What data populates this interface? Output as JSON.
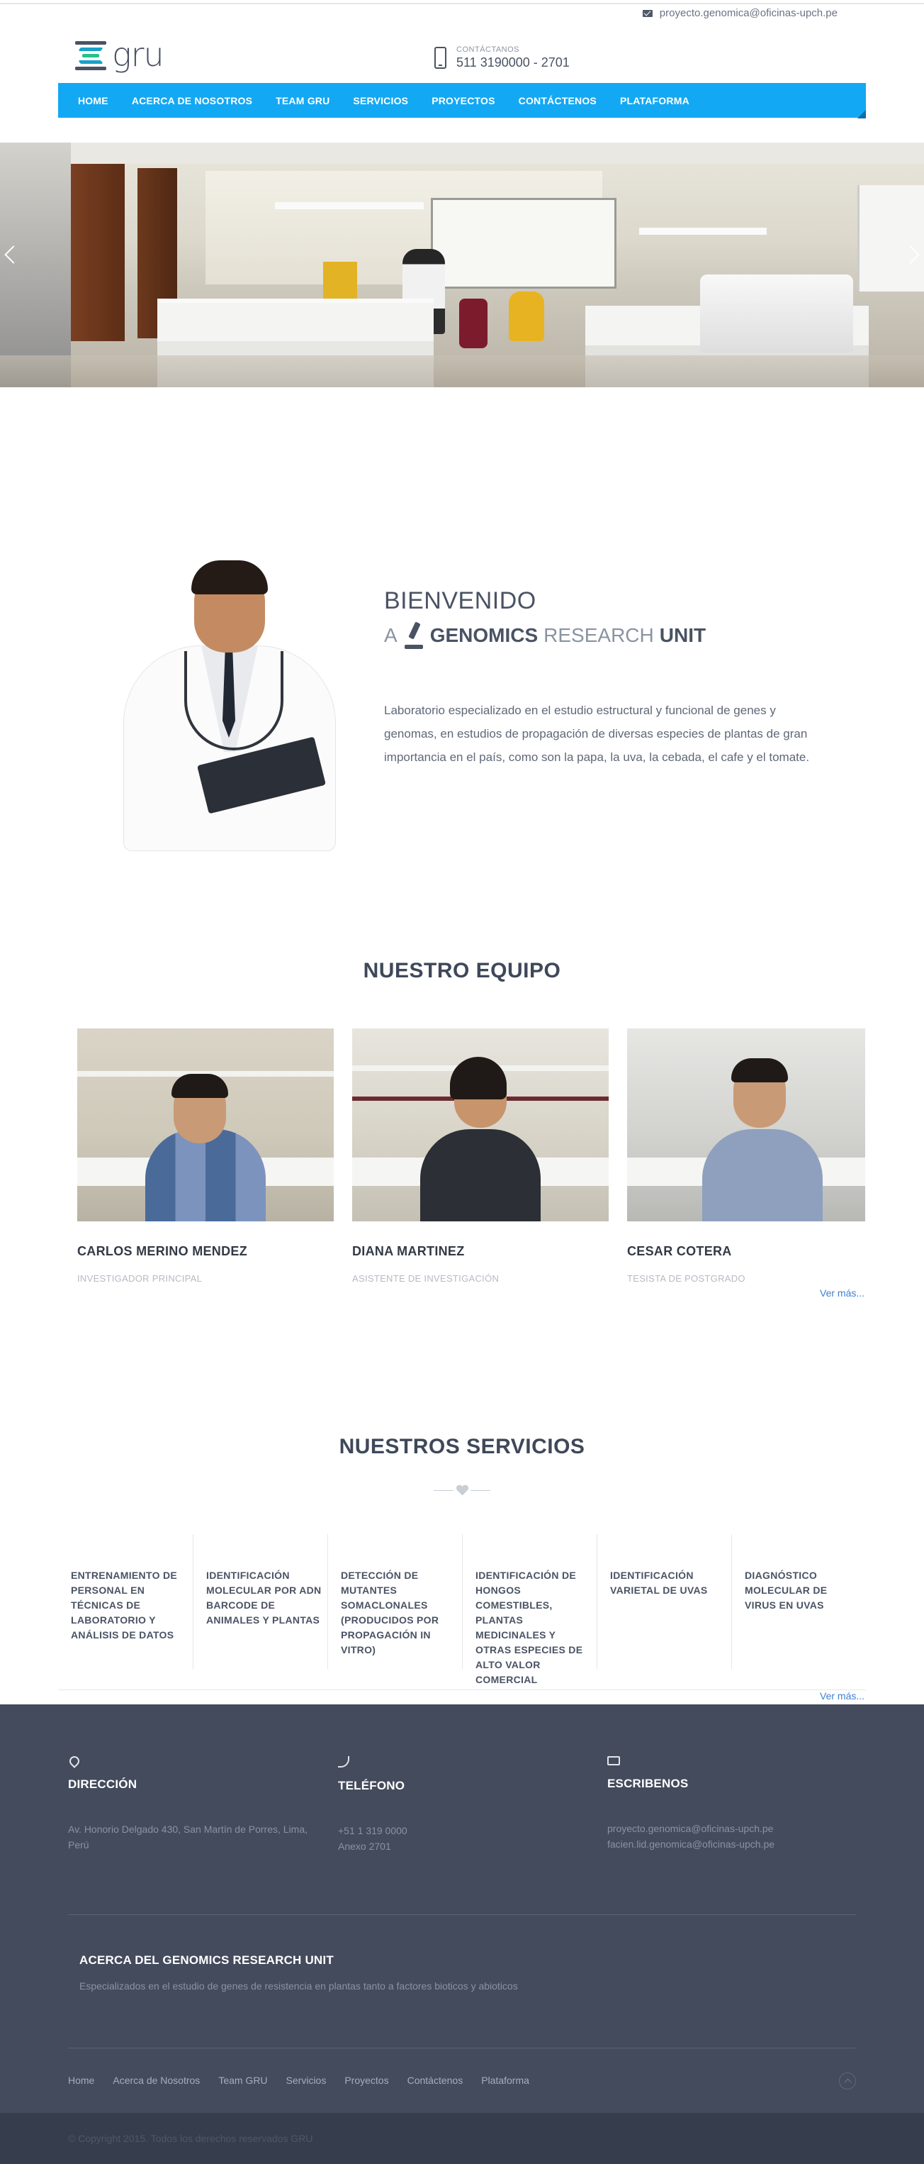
{
  "topbar": {
    "email": "proyecto.genomica@oficinas-upch.pe"
  },
  "header": {
    "logo_text": "gru",
    "contact_label": "CONTÁCTANOS",
    "contact_phone": "511 3190000 - 2701"
  },
  "nav": {
    "items": [
      "HOME",
      "ACERCA DE NOSOTROS",
      "TEAM GRU",
      "SERVICIOS",
      "PROYECTOS",
      "CONTÁCTENOS",
      "PLATAFORMA"
    ]
  },
  "welcome": {
    "title": "BIENVENIDO",
    "sub_a": "A",
    "sub_genomics": "GENOMICS",
    "sub_research": "RESEARCH",
    "sub_unit": "UNIT",
    "text": "Laboratorio especializado en el estudio estructural y funcional de genes y genomas, en estudios de propagación de diversas especies de plantas de gran importancia en el país, como son la papa, la uva, la cebada, el cafe y el tomate."
  },
  "team": {
    "title": "NUESTRO EQUIPO",
    "members": [
      {
        "name": "CARLOS MERINO MENDEZ",
        "role": "INVESTIGADOR PRINCIPAL"
      },
      {
        "name": "DIANA MARTINEZ",
        "role": "ASISTENTE DE INVESTIGACIÓN"
      },
      {
        "name": "CESAR COTERA",
        "role": "TESISTA DE POSTGRADO"
      }
    ],
    "see_more": "Ver más..."
  },
  "services": {
    "title": "NUESTROS SERVICIOS",
    "items": [
      "ENTRENAMIENTO DE PERSONAL EN TÉCNICAS DE LABORATORIO Y ANÁLISIS DE DATOS",
      "IDENTIFICACIÓN MOLECULAR POR ADN BARCODE DE ANIMALES Y PLANTAS",
      "DETECCIÓN DE MUTANTES SOMACLONALES (PRODUCIDOS POR PROPAGACIÓN IN VITRO)",
      "IDENTIFICACIÓN DE HONGOS COMESTIBLES, PLANTAS MEDICINALES Y OTRAS ESPECIES DE ALTO VALOR COMERCIAL",
      "IDENTIFICACIÓN VARIETAL DE UVAS",
      "DIAGNÓSTICO MOLECULAR DE VIRUS EN UVAS"
    ],
    "see_more": "Ver más..."
  },
  "footer": {
    "address_title": "DIRECCIÓN",
    "address_text": "Av. Honorio Delgado 430, San Martín de Porres, Lima, Perú",
    "phone_title": "TELÉFONO",
    "phone_line1": "+51 1 319 0000",
    "phone_line2": "Anexo 2701",
    "write_title": "ESCRIBENOS",
    "email1": "proyecto.genomica@oficinas-upch.pe",
    "email2": "facien.lid.genomica@oficinas-upch.pe",
    "about_title": "ACERCA DEL GENOMICS RESEARCH UNIT",
    "about_text": "Especializados en el estudio de genes de resistencia en plantas tanto a factores bioticos y abioticos",
    "links": [
      "Home",
      "Acerca de Nosotros",
      "Team GRU",
      "Servicios",
      "Proyectos",
      "Contáctenos",
      "Plataforma"
    ],
    "copyright": "© Copyright 2015. Todos los derechos reservados GRU"
  },
  "colors": {
    "nav_blue": "#13a8f4",
    "footer_bg": "#434b5c",
    "heading": "#4a5364",
    "link": "#3f7fcf"
  }
}
